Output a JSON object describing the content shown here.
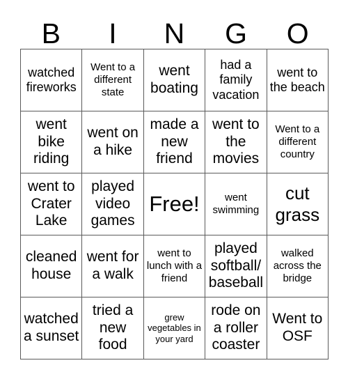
{
  "card": {
    "title": "BINGO",
    "header_letters": [
      "B",
      "I",
      "N",
      "G",
      "O"
    ],
    "rows": 5,
    "columns": 5,
    "border_color": "#5a5a5a",
    "text_color": "#000000",
    "background_color": "#ffffff",
    "cells": [
      {
        "text": "watched fireworks",
        "size": "md",
        "free": false
      },
      {
        "text": "Went to a different state",
        "size": "sm",
        "free": false
      },
      {
        "text": "went boating",
        "size": "lg",
        "free": false
      },
      {
        "text": "had a family vacation",
        "size": "md",
        "free": false
      },
      {
        "text": "went to the beach",
        "size": "md",
        "free": false
      },
      {
        "text": "went bike riding",
        "size": "lg",
        "free": false
      },
      {
        "text": "went on a hike",
        "size": "lg",
        "free": false
      },
      {
        "text": "made a new friend",
        "size": "lg",
        "free": false
      },
      {
        "text": "went to the movies",
        "size": "lg",
        "free": false
      },
      {
        "text": "Went to a different country",
        "size": "sm",
        "free": false
      },
      {
        "text": "went to Crater Lake",
        "size": "lg",
        "free": false
      },
      {
        "text": "played video games",
        "size": "lg",
        "free": false
      },
      {
        "text": "Free!",
        "size": "free",
        "free": true
      },
      {
        "text": "went swimming",
        "size": "sm",
        "free": false
      },
      {
        "text": "cut grass",
        "size": "xl",
        "free": false
      },
      {
        "text": "cleaned house",
        "size": "lg",
        "free": false
      },
      {
        "text": "went for a walk",
        "size": "lg",
        "free": false
      },
      {
        "text": "went to lunch with a friend",
        "size": "sm",
        "free": false
      },
      {
        "text": "played softball/ baseball",
        "size": "lg",
        "free": false
      },
      {
        "text": "walked across the bridge",
        "size": "sm",
        "free": false
      },
      {
        "text": "watched a sunset",
        "size": "lg",
        "free": false
      },
      {
        "text": "tried a new food",
        "size": "lg",
        "free": false
      },
      {
        "text": "grew vegetables in your yard",
        "size": "xs",
        "free": false
      },
      {
        "text": "rode on a roller coaster",
        "size": "lg",
        "free": false
      },
      {
        "text": "Went to OSF",
        "size": "lg",
        "free": false
      }
    ]
  }
}
